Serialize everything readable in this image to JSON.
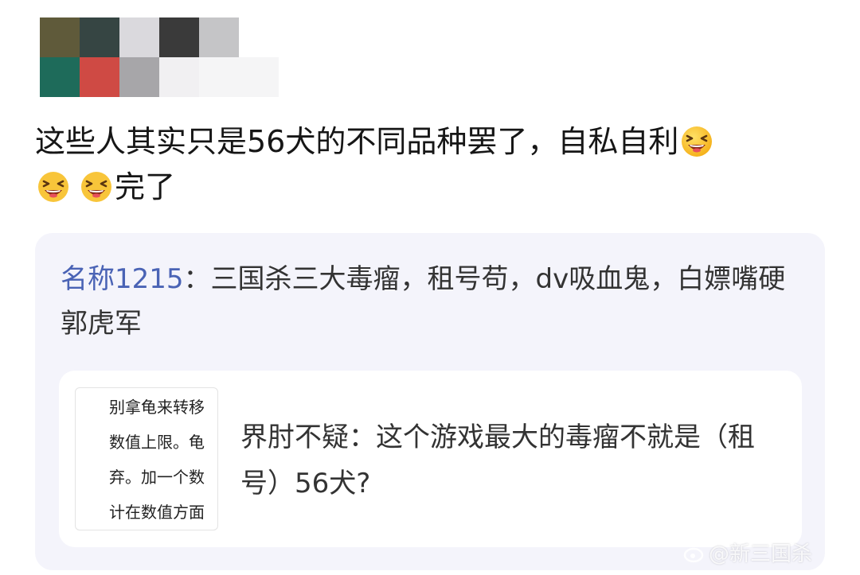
{
  "post": {
    "text_main": "这些人其实只是56犬的不同品种罢了，自私自利",
    "text_end": "完了",
    "emoji_name": "grinning-squinting-emoji"
  },
  "quote": {
    "author": "名称1215",
    "separator": "：",
    "text": "三国杀三大毒瘤，租号苟，dv吸血鬼，白嫖嘴硬郭虎军"
  },
  "reply": {
    "author": "界肘不疑",
    "separator": "：",
    "text": "这个游戏最大的毒瘤不就是（租号）56犬?",
    "thumbnail_lines": [
      "别拿龟来转移",
      "数值上限。龟",
      "弃。加一个数",
      "计在数值方面"
    ]
  },
  "watermark": {
    "text": "@新三国杀",
    "icon": "weibo-logo-icon"
  },
  "colors": {
    "author_link": "#4a63b5",
    "card_bg": "#f4f4fb"
  }
}
